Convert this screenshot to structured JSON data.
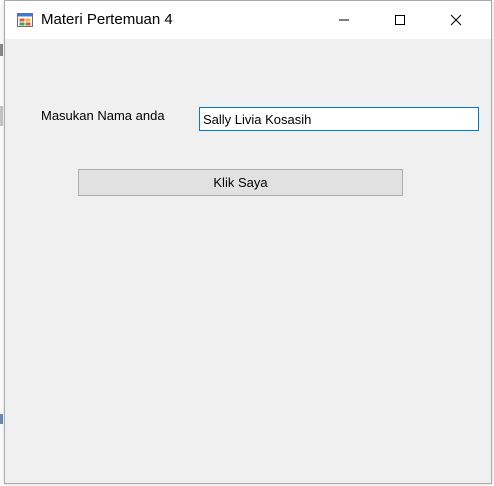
{
  "window": {
    "title": "Materi Pertemuan 4",
    "icon": "windows-forms-app-icon",
    "controls": {
      "minimize": "minimize-icon",
      "maximize": "maximize-icon",
      "close": "close-icon"
    }
  },
  "form": {
    "name_label": "Masukan Nama anda",
    "name_value": "Sally Livia Kosasih",
    "submit_label": "Klik Saya"
  },
  "colors": {
    "client_background": "#f0f0f0",
    "titlebar_background": "#ffffff",
    "focus_border": "#0078d7",
    "button_background": "#e1e1e1"
  }
}
